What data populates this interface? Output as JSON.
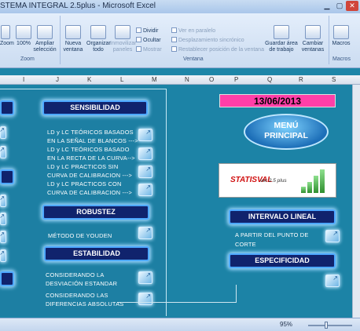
{
  "window": {
    "title": "STEMA INTEGRAL 2.5plus - Microsoft Excel"
  },
  "ribbon": {
    "zoom_group": {
      "label": "Zoom",
      "items": [
        "Zoom",
        "100%",
        "Ampliar\nselección"
      ]
    },
    "window_group": {
      "label": "Ventana",
      "nueva": "Nueva\nventana",
      "organizar": "Organizar\ntodo",
      "inmovilizar": "Inmovilizar\npaneles",
      "dividir": "Dividir",
      "ocultar": "Ocultar",
      "mostrar": "Mostrar",
      "ver_paralelo": "Ver en paralelo",
      "desplazamiento": "Desplazamiento sincrónico",
      "restablecer": "Restablecer posición de la ventana",
      "guardar": "Guardar área\nde trabajo",
      "cambiar": "Cambiar\nventanas"
    },
    "macros_group": {
      "label": "Macros",
      "macros": "Macros"
    }
  },
  "columns": [
    "I",
    "J",
    "K",
    "L",
    "M",
    "N",
    "O",
    "P",
    "Q",
    "R",
    "S"
  ],
  "sheet": {
    "headers": {
      "sensibilidad": "SENSIBILIDAD",
      "robustez": "ROBUSTEZ",
      "estabilidad": "ESTABILIDAD",
      "intervalo": "INTERVALO LINEAL",
      "especificidad": "ESPECIFICIDAD"
    },
    "sens_items": [
      "LD y LC TEÓRICOS BASADOS",
      "EN LA SEÑAL DE BLANCOS --->",
      "LD y LC TEÓRICOS BASADO",
      "EN LA RECTA DE LA CURVA-->",
      "LD y LC PRACTICOS SIN",
      "CURVA DE CALIBRACION --->",
      "LD y LC PRACTICOS CON",
      "CURVA DE CALIBRACION --->"
    ],
    "robustez_item": "MÉTODO DE YOUDEN",
    "estab_items": [
      "CONSIDERANDO LA",
      "DESVIACIÓN ESTANDAR",
      "CONSIDERANDO LAS",
      "DIFERENCIAS ABSOLUTAS"
    ],
    "intervalo_items": [
      "A PARTIR DEL PUNTO DE",
      "CORTE"
    ],
    "date": "13/06/2013",
    "menu": "MENÚ\nPRINCIPAL",
    "logo": {
      "name": "STATISVAL",
      "version": "ver 2.5 plus"
    }
  },
  "status": {
    "zoom": "95%"
  }
}
